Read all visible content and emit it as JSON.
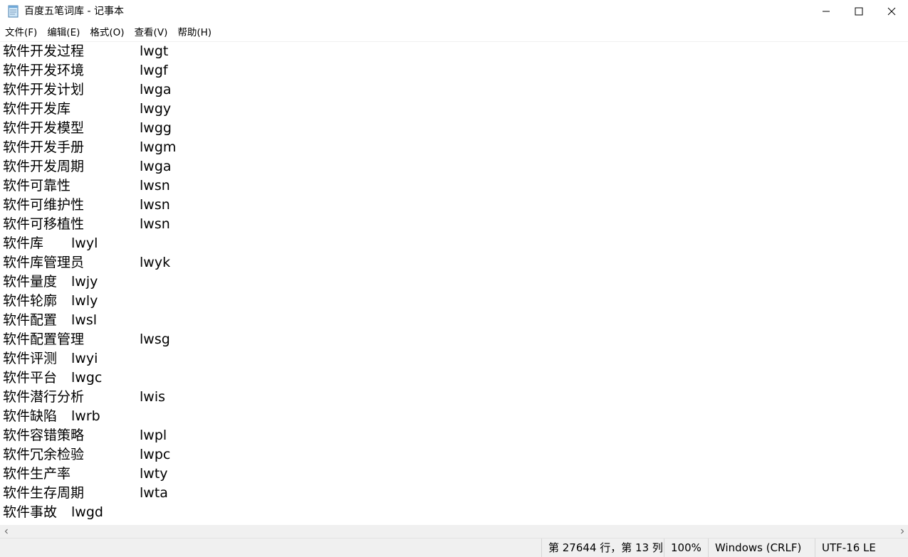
{
  "window": {
    "title": "百度五笔词库 - 记事本",
    "icon": "notepad-icon"
  },
  "menu": [
    {
      "label": "文件(F)"
    },
    {
      "label": "编辑(E)"
    },
    {
      "label": "格式(O)"
    },
    {
      "label": "查看(V)"
    },
    {
      "label": "帮助(H)"
    }
  ],
  "editor": {
    "lines": [
      {
        "term": "软件开发过程",
        "code": "lwgt"
      },
      {
        "term": "软件开发环境",
        "code": "lwgf"
      },
      {
        "term": "软件开发计划",
        "code": "lwga"
      },
      {
        "term": "软件开发库",
        "code": "lwgy"
      },
      {
        "term": "软件开发模型",
        "code": "lwgg"
      },
      {
        "term": "软件开发手册",
        "code": "lwgm"
      },
      {
        "term": "软件开发周期",
        "code": "lwga"
      },
      {
        "term": "软件可靠性",
        "code": "lwsn"
      },
      {
        "term": "软件可维护性",
        "code": "lwsn"
      },
      {
        "term": "软件可移植性",
        "code": "lwsn"
      },
      {
        "term": "软件库",
        "code": "lwyl"
      },
      {
        "term": "软件库管理员",
        "code": "lwyk"
      },
      {
        "term": "软件量度",
        "code": "lwjy"
      },
      {
        "term": "软件轮廓",
        "code": "lwly"
      },
      {
        "term": "软件配置",
        "code": "lwsl"
      },
      {
        "term": "软件配置管理",
        "code": "lwsg"
      },
      {
        "term": "软件评测",
        "code": "lwyi"
      },
      {
        "term": "软件平台",
        "code": "lwgc"
      },
      {
        "term": "软件潜行分析",
        "code": "lwis"
      },
      {
        "term": "软件缺陷",
        "code": "lwrb"
      },
      {
        "term": "软件容错策略",
        "code": "lwpl"
      },
      {
        "term": "软件冗余检验",
        "code": "lwpc"
      },
      {
        "term": "软件生产率",
        "code": "lwty"
      },
      {
        "term": "软件生存周期",
        "code": "lwta"
      },
      {
        "term": "软件事故",
        "code": "lwgd"
      }
    ]
  },
  "status": {
    "position": "第 27644 行，第 13 列",
    "zoom": "100%",
    "line_ending": "Windows (CRLF)",
    "encoding": "UTF-16 LE"
  }
}
